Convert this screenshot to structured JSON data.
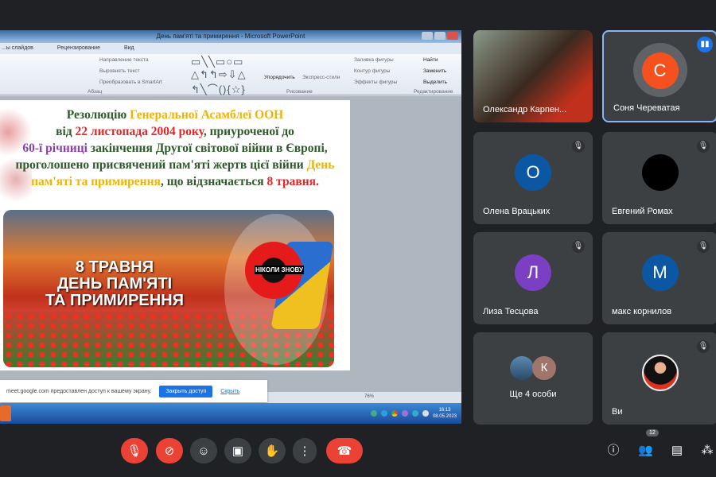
{
  "presentation": {
    "window_title": "День пам'яті та примирення - Microsoft PowerPoint",
    "tabs": [
      "...ы слайдов",
      "Рецензирование",
      "Вид"
    ],
    "ribbon": {
      "text_direction": "Направление текста",
      "align_text": "Выровнять текст",
      "smartart": "Преобразовать в SmartArt",
      "paragraph_group": "Абзац",
      "arrange": "Упорядочить",
      "quick_styles": "Экспресс-стили",
      "shape_fill": "Заливка фигуры",
      "shape_outline": "Контур фигуры",
      "shape_effects": "Эффекты фигуры",
      "drawing_group": "Рисование",
      "find": "Найти",
      "replace": "Заменить",
      "select": "Выделить",
      "editing_group": "Редактирование"
    },
    "slide": {
      "p1": "Резолюцію ",
      "p2": "Генеральної Асамблеї ООН",
      "p3": "від ",
      "p4": "22 листопада 2004 року",
      "p5": ", приуроченої до",
      "p6": "60-ї річниці",
      "p7": " закінчення Другої світової війни в Європі, проголошено присвячений пам'яті жертв цієї війни ",
      "p8": "День пам'яті та примирення",
      "p9": ", що відзначається ",
      "p10": "8 травня.",
      "banner_line1": "8 ТРАВНЯ",
      "banner_line2": "ДЕНЬ ПАМ'ЯТІ",
      "banner_line3": "ТА ПРИМИРЕННЯ",
      "badge_text": "НІКОЛИ ЗНОВУ",
      "badge_years": "1939 1945"
    },
    "zoom_level": "76%",
    "share_notice": {
      "text": "meet.google.com предоставлен доступ к вашему экрану.",
      "close_button": "Закрыть доступ",
      "hide_link": "Скрыть"
    },
    "clock": {
      "time": "16:13",
      "date": "08.05.2023"
    }
  },
  "participants": [
    {
      "name": "Олександр Карпен...",
      "type": "video"
    },
    {
      "name": "Соня Череватая",
      "initial": "С",
      "color": "#f4511e",
      "speaking": true
    },
    {
      "name": "Олена Врацьких",
      "initial": "О",
      "color": "#0b57a4",
      "muted": true
    },
    {
      "name": "Евгений Ромах",
      "initial": "",
      "color": "#000000",
      "muted": true
    },
    {
      "name": "Лиза Тесцова",
      "initial": "Л",
      "color": "#7b3fc4",
      "muted": true
    },
    {
      "name": "макс корнилов",
      "initial": "М",
      "color": "#0b57a4",
      "muted": true
    },
    {
      "name": "Ще 4 особи",
      "initial": "К",
      "color": "#a1766a"
    },
    {
      "name": "Ви",
      "type": "photo",
      "muted": true
    }
  ],
  "controls": {
    "participants_count": "12",
    "icons": [
      "mic-off-icon",
      "camera-off-icon",
      "emoji-icon",
      "present-icon",
      "raise-hand-icon",
      "more-icon",
      "hang-up-icon",
      "info-icon",
      "people-icon",
      "chat-icon",
      "activities-icon"
    ]
  },
  "colors": {
    "background": "#202124",
    "tile": "#3c4043",
    "danger": "#ea4335",
    "accent": "#1a73e8"
  }
}
